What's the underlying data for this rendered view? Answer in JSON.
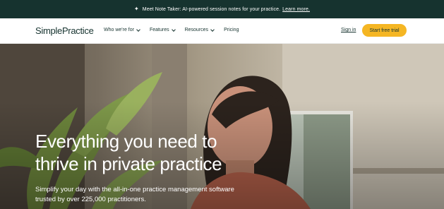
{
  "announcement": {
    "icon": "sparkle-icon",
    "text": "Meet Note Taker: AI-powered session notes for your practice.",
    "link": "Learn more."
  },
  "nav": {
    "logo_part1": "Simple",
    "logo_part2": "Practice",
    "menu": [
      {
        "label": "Who we're for",
        "has_dropdown": true
      },
      {
        "label": "Features",
        "has_dropdown": true
      },
      {
        "label": "Resources",
        "has_dropdown": true
      },
      {
        "label": "Pricing",
        "has_dropdown": false
      }
    ],
    "sign_in": "Sign in",
    "cta": "Start free trial"
  },
  "hero": {
    "headline_line1": "Everything you need to",
    "headline_line2": "thrive in private practice",
    "subhead_line1": "Simplify your day with the all-in-one practice management software",
    "subhead_line2": "trusted by over 225,000 practitioners."
  },
  "colors": {
    "brand_dark": "#16332f",
    "accent_yellow": "#f5b623",
    "white": "#ffffff"
  }
}
